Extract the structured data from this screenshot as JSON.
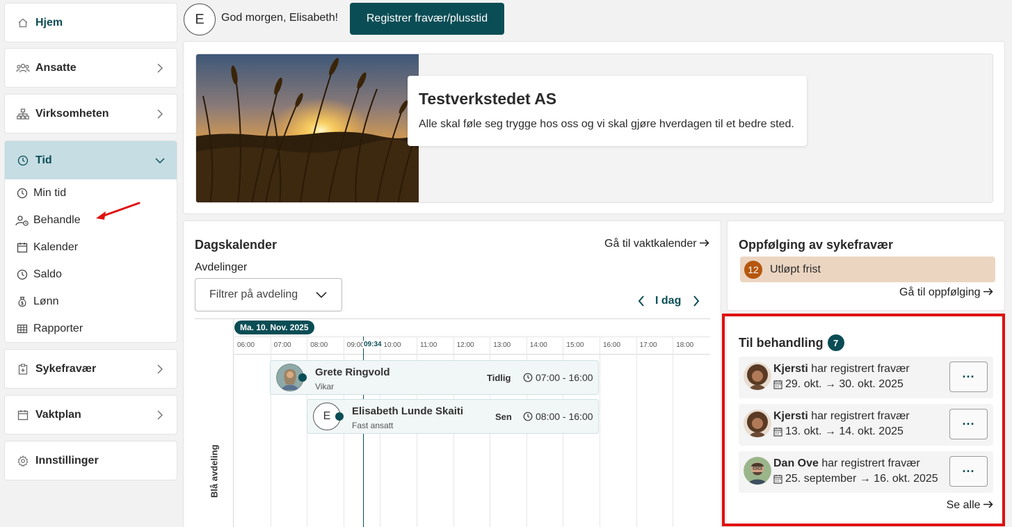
{
  "sidebar": {
    "home": "Hjem",
    "ansatte": "Ansatte",
    "virksomheten": "Virksomheten",
    "tid": "Tid",
    "tid_items": [
      "Min tid",
      "Behandle",
      "Kalender",
      "Saldo",
      "Lønn",
      "Rapporter"
    ],
    "sykefravaer": "Sykefravær",
    "vaktplan": "Vaktplan",
    "innstillinger": "Innstillinger"
  },
  "topbar": {
    "avatar_initial": "E",
    "greeting": "God morgen, Elisabeth!",
    "register_button": "Registrer fravær/plusstid"
  },
  "banner": {
    "title": "Testverkstedet AS",
    "subtitle": "Alle skal føle seg trygge hos oss og vi skal gjøre hverdagen til et bedre sted."
  },
  "calendar": {
    "title": "Dagskalender",
    "link": "Gå til vaktkalender",
    "department_label": "Avdelinger",
    "filter_placeholder": "Filtrer på avdeling",
    "today_label": "I dag",
    "date_pill": "Ma. 10. Nov. 2025",
    "hours": [
      "06:00",
      "07:00",
      "08:00",
      "09:00",
      "10:00",
      "11:00",
      "12:00",
      "13:00",
      "14:00",
      "15:00",
      "16:00",
      "17:00",
      "18:00"
    ],
    "now": "09:34",
    "department": "Blå avdeling",
    "shifts": [
      {
        "name": "Grete Ringvold",
        "role": "Vikar",
        "type": "Tidlig",
        "time": "07:00 - 16:00"
      },
      {
        "name": "Elisabeth Lunde Skaiti",
        "role": "Fast ansatt",
        "type": "Sen",
        "time": "08:00 - 16:00",
        "initial": "E"
      }
    ]
  },
  "followup": {
    "title": "Oppfølging av sykefravær",
    "count": "12",
    "alert": "Utløpt frist",
    "link": "Gå til oppfølging"
  },
  "pending": {
    "title": "Til behandling",
    "count": "7",
    "items": [
      {
        "name": "Kjersti",
        "action": "har registrert fravær",
        "dates": "29. okt. → 30. okt. 2025"
      },
      {
        "name": "Kjersti",
        "action": "har registrert fravær",
        "dates": "13. okt. → 14. okt. 2025"
      },
      {
        "name": "Dan Ove",
        "action": "har registrert fravær",
        "dates": "25. september → 16. okt. 2025"
      }
    ],
    "more_label": "···",
    "see_all": "Se alle"
  },
  "colors": {
    "brand": "#0b4d55",
    "active_nav": "#c5dde3",
    "alert_bg": "#ebd5c1",
    "alert_badge": "#b5570e",
    "highlight": "#e01010"
  }
}
